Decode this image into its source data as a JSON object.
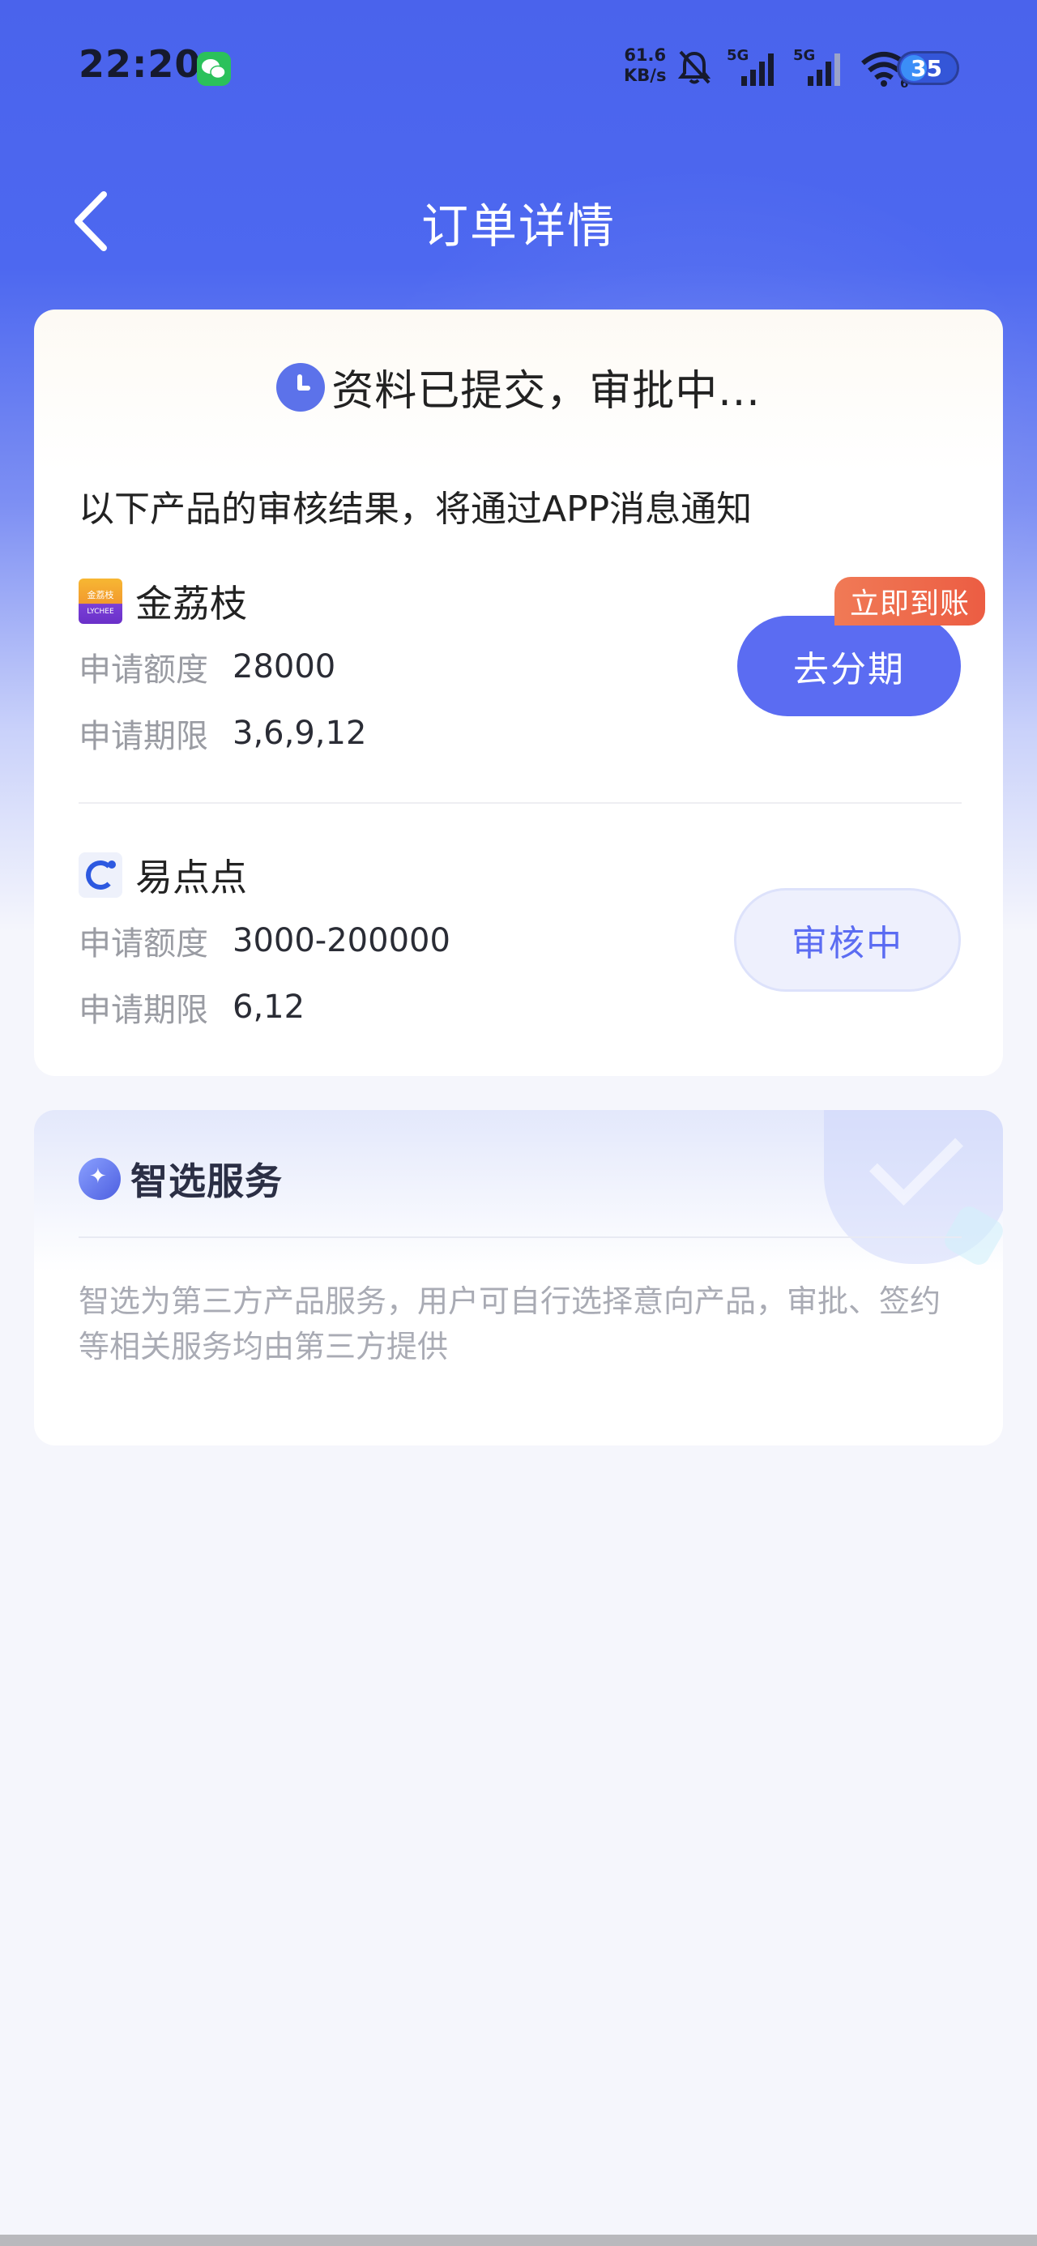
{
  "status_bar": {
    "time": "22:20",
    "net_speed_value": "61.6",
    "net_speed_unit": "KB/s",
    "signal1_label": "5G",
    "signal2_label": "5G",
    "wifi_label": "6",
    "battery_level": "35"
  },
  "nav": {
    "title": "订单详情"
  },
  "order": {
    "status_text": "资料已提交，审批中...",
    "notice": "以下产品的审核结果，将通过APP消息通知",
    "products": [
      {
        "name": "金荔枝",
        "logo_text_top": "金荔枝",
        "logo_text_bottom": "LYCHEE",
        "amount_label": "申请额度",
        "amount_value": "28000",
        "term_label": "申请期限",
        "term_value": "3,6,9,12",
        "button_label": "去分期",
        "badge": "立即到账"
      },
      {
        "name": "易点点",
        "logo_text": "易点点",
        "amount_label": "申请额度",
        "amount_value": "3000-200000",
        "term_label": "申请期限",
        "term_value": "6,12",
        "button_label": "审核中"
      }
    ]
  },
  "service": {
    "title": "智选服务",
    "description": "智选为第三方产品服务，用户可自行选择意向产品，审批、签约等相关服务均由第三方提供"
  },
  "colors": {
    "primary": "#5b6cf2",
    "header_blue": "#4a63ec",
    "badge_orange": "#ec5d43"
  }
}
